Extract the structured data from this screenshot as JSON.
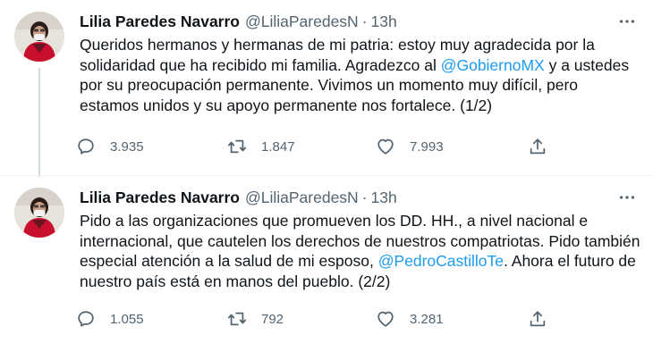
{
  "tweets": [
    {
      "author": {
        "name": "Lilia Paredes Navarro",
        "handle": "@LiliaParedesN",
        "time": "13h",
        "avatar_icon": "profile-photo"
      },
      "text": {
        "part1": "Queridos hermanos y hermanas de mi patria: estoy muy agradecida por la solidaridad que ha recibido mi familia. Agradezco al ",
        "mention": "@GobiernoMX",
        "part2": " y a ustedes por su preocupación permanente. Vivimos un momento muy difícil, pero estamos unidos y su apoyo permanente nos fortalece. (1/2)"
      },
      "stats": {
        "replies": "3.935",
        "retweets": "1.847",
        "likes": "7.993"
      }
    },
    {
      "author": {
        "name": "Lilia Paredes Navarro",
        "handle": "@LiliaParedesN",
        "time": "13h",
        "avatar_icon": "profile-photo"
      },
      "text": {
        "part1": "Pido a las organizaciones que promueven los DD. HH., a nivel nacional e internacional, que cautelen los derechos de nuestros compatriotas. Pido también especial atención a la salud de mi esposo, ",
        "mention": "@PedroCastilloTe",
        "part2": ". Ahora el futuro de nuestro país está en manos del pueblo. (2/2)"
      },
      "stats": {
        "replies": "1.055",
        "retweets": "792",
        "likes": "3.281"
      }
    }
  ],
  "ui": {
    "separator": "·",
    "icons": {
      "reply": "reply-icon",
      "retweet": "retweet-icon",
      "like": "heart-icon",
      "share": "share-icon",
      "more": "more-options-icon"
    },
    "colors": {
      "text": "#0f1419",
      "secondary": "#536471",
      "link": "#1d9bf0",
      "thread_line": "#cfd9de"
    }
  }
}
